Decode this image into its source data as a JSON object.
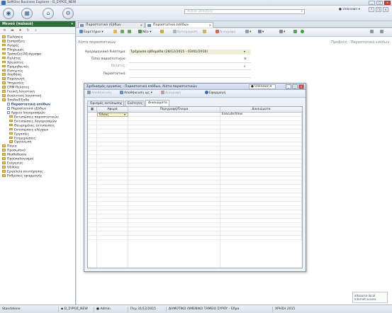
{
  "window": {
    "title": "SoftOne Business Explorer - D_ΣΥΡΟΣ_NEW",
    "user": "Unknown"
  },
  "ribbon": {
    "search_placeholder": "Active Directory"
  },
  "nav": {
    "header": "Μενού (παλαιό)",
    "items": [
      {
        "label": "Πωλήσεις",
        "level": 0
      },
      {
        "label": "Εισπράξεις",
        "level": 0
      },
      {
        "label": "Αγορές",
        "level": 0
      },
      {
        "label": "Πληρωμές",
        "level": 0
      },
      {
        "label": "Τράπεζες/Αξιόγραφα",
        "level": 0
      },
      {
        "label": "Πελάτες",
        "level": 0
      },
      {
        "label": "Χρεώστες",
        "level": 0
      },
      {
        "label": "Προμηθευτές",
        "level": 0
      },
      {
        "label": "Πιστωτές",
        "level": 0
      },
      {
        "label": "Αποθήκη",
        "level": 0
      },
      {
        "label": "Παραγωγή",
        "level": 0
      },
      {
        "label": "Υπηρεσίες",
        "level": 0
      },
      {
        "label": "CRM Πελάτες",
        "level": 0
      },
      {
        "label": "Γενική λογιστική",
        "level": 0
      },
      {
        "label": "Αναλυτική λογιστική",
        "level": 0
      },
      {
        "label": "Έσοδα/Έξοδα",
        "level": 0
      },
      {
        "label": "Παραστατικά εσόδων",
        "level": 1,
        "selected": true
      },
      {
        "label": "Παραστατικά εξόδων",
        "level": 1
      },
      {
        "label": "Αρχείο λογαριασμών",
        "level": 1
      },
      {
        "label": "Εκτυπώσεις παραστατικών",
        "level": 2
      },
      {
        "label": "Εκτυπώσεις λογαριασμών",
        "level": 2
      },
      {
        "label": "Θεωρημένες εκτυπώσεις",
        "level": 2
      },
      {
        "label": "Εκτυπώσεις ελέγχων",
        "level": 2
      },
      {
        "label": "Εργασίες",
        "level": 2
      },
      {
        "label": "Ενημερώσεις",
        "level": 2
      },
      {
        "label": "Οργάνωση",
        "level": 2
      },
      {
        "label": "Πάγια",
        "level": 0
      },
      {
        "label": "Προσωπικό",
        "level": 0
      },
      {
        "label": "Μισθοδοσία",
        "level": 0
      },
      {
        "label": "Προϋπολογισμοί",
        "level": 0
      },
      {
        "label": "Ενέργειες",
        "level": 0
      },
      {
        "label": "Utilities",
        "level": 0
      },
      {
        "label": "Εργαλεία συντήρησης",
        "level": 0
      },
      {
        "label": "Ρυθμίσεις εφαρμογής",
        "level": 0
      }
    ]
  },
  "tabs": [
    {
      "label": "Παραστατικά εξόδων",
      "active": false
    },
    {
      "label": "Παραστατικά εσόδων",
      "active": true
    }
  ],
  "toolbar": {
    "new_pick": "Ευρετήριο",
    "new_label": "Νέο",
    "save_label": "Καταχώριση",
    "delete_label": "Διαγραφή"
  },
  "form": {
    "section_title": "Λίστα παραστατικών",
    "right_title": "Προβολή : Παραστατικά εσόδων",
    "fields": [
      {
        "label": "Ημερομηνιακό διάστημα:",
        "value": "Τρέχουσα εβδομάδα (28/12/2015 - 03/01/2016)"
      },
      {
        "label": "Τύποι παραστατικών:",
        "value": ""
      },
      {
        "label": "Πελάτες:",
        "value": ""
      },
      {
        "label": "Παραστατικό:",
        "value": ""
      }
    ]
  },
  "dialog": {
    "title": "Σχεδιασμός εργασίας : Παραστατικά εσόδων, Λίστα παραστατικών",
    "user": "Unknown",
    "toolbar": {
      "save": "Αποθήκευση",
      "save_as": "Αποθήκευση ως",
      "delete": "Διαγραφή",
      "apply": "Εφαρμογή"
    },
    "tabs": [
      "Ορισμός εκτύπωσης",
      "Ενότητες",
      "Δικαιώματα"
    ],
    "columns": [
      "Αφορά",
      "Περιγραφή/Όνομα",
      "Δικαιώματα"
    ],
    "rows": [
      {
        "col1": "Όλους",
        "col2": "",
        "col3": "Execute/View"
      }
    ]
  },
  "status": {
    "mode": "Standalone",
    "company": "D_ΣΥΡΟΣ_NEW",
    "user": "Admin",
    "date": "Πεμ 31/12/2015",
    "org": "ΔΗΜΟΤΙΚΟ ΛΙΜΕΝΙΚΟ ΤΑΜΕΙΟ ΣΥΡΟΥ - Έδρα",
    "year": "ΧΡΗΣΗ 2015"
  },
  "badge": {
    "line1": "altsource.local",
    "line2": "Internet access"
  }
}
